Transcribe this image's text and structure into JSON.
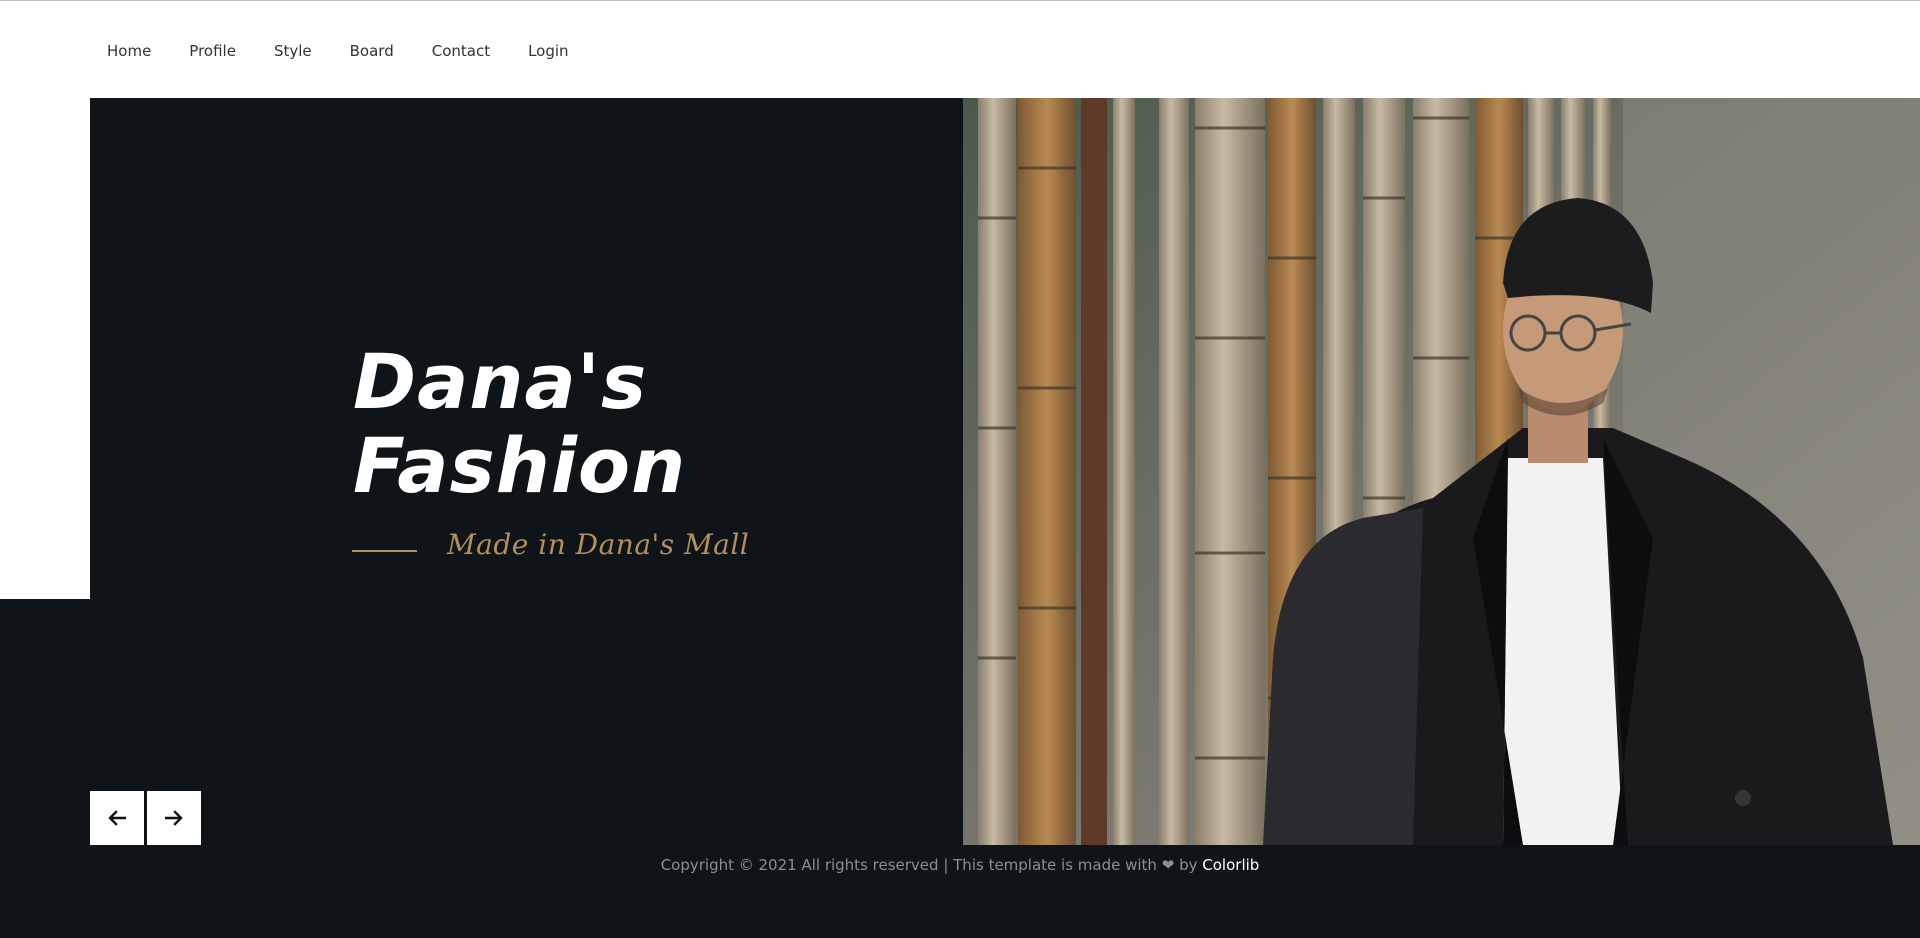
{
  "nav": {
    "items": [
      {
        "label": "Home"
      },
      {
        "label": "Profile"
      },
      {
        "label": "Style"
      },
      {
        "label": "Board"
      },
      {
        "label": "Contact"
      },
      {
        "label": "Login"
      }
    ]
  },
  "hero": {
    "title_line1": "Dana's",
    "title_line2": "Fashion",
    "tagline": "Made in Dana's Mall"
  },
  "slider": {
    "prev_icon": "arrow-left-icon",
    "next_icon": "arrow-right-icon"
  },
  "footer": {
    "copyright": "Copyright © 2021 All rights reserved | This template is made with",
    "by": "by",
    "link_text": "Colorlib",
    "heart_icon": "heart-icon"
  },
  "colors": {
    "dark_bg": "#0e1417",
    "accent_gold": "#b58d5e",
    "white": "#ffffff"
  }
}
